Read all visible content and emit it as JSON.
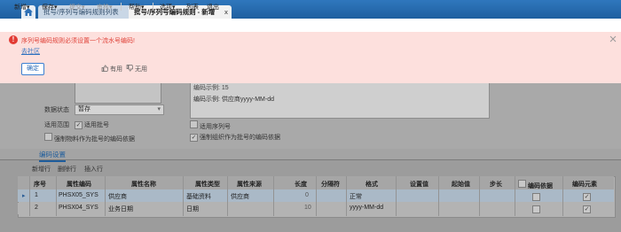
{
  "tabs": {
    "home_icon": "home-icon",
    "items": [
      {
        "label": "批号/序列号编码规则列表"
      },
      {
        "label": "批号/序列号编码规则 - 新增",
        "close": "x"
      }
    ]
  },
  "toolbar": {
    "items": [
      {
        "label": "新增",
        "dropdown": "▾"
      },
      {
        "label": "保存",
        "dropdown": "▾"
      },
      {
        "label": "提交",
        "dropdown": "▾"
      },
      {
        "label": "审核",
        "dropdown": "▾"
      },
      {
        "label": "帮助",
        "dropdown": "▾"
      },
      {
        "label": "选项",
        "dropdown": "▾"
      },
      {
        "label": "列表"
      },
      {
        "label": "退出"
      }
    ]
  },
  "banner": {
    "icon": "!",
    "message": "序列号编码规则必须设置一个流水号编码!",
    "link": "去社区",
    "ok": "确定",
    "useful": "有用",
    "useless": "无用"
  },
  "form": {
    "example_partial": "编码示例: 15",
    "example": "编码示例: 供应商yyyy-MM-dd",
    "status_label": "数据状态",
    "status_value": "暂存",
    "scope_label": "适用范围",
    "apply_batch": "适用批号",
    "apply_serial": "适用序列号",
    "force_material": "强制物料作为批号的编码依据",
    "force_org": "强制组织作为批号的编码依据"
  },
  "section": {
    "tab": "编码设置"
  },
  "grid_toolbar": {
    "add": "新增行",
    "delete": "删除行",
    "insert": "插入行"
  },
  "grid": {
    "headers": [
      "序号",
      "属性编码",
      "属性名称",
      "属性类型",
      "属性来源",
      "长度",
      "分隔符",
      "格式",
      "设置值",
      "起始值",
      "步长",
      "编码依据",
      "编码元素"
    ],
    "rows": [
      {
        "seq": "1",
        "code": "PHSX05_SYS",
        "name": "供应商",
        "type": "基础资料",
        "source": "供应商",
        "length": "0",
        "format": "正常"
      },
      {
        "seq": "2",
        "code": "PHSX04_SYS",
        "name": "业务日期",
        "type": "日期",
        "source": "",
        "length": "10",
        "format": "yyyy-MM-dd"
      }
    ]
  }
}
